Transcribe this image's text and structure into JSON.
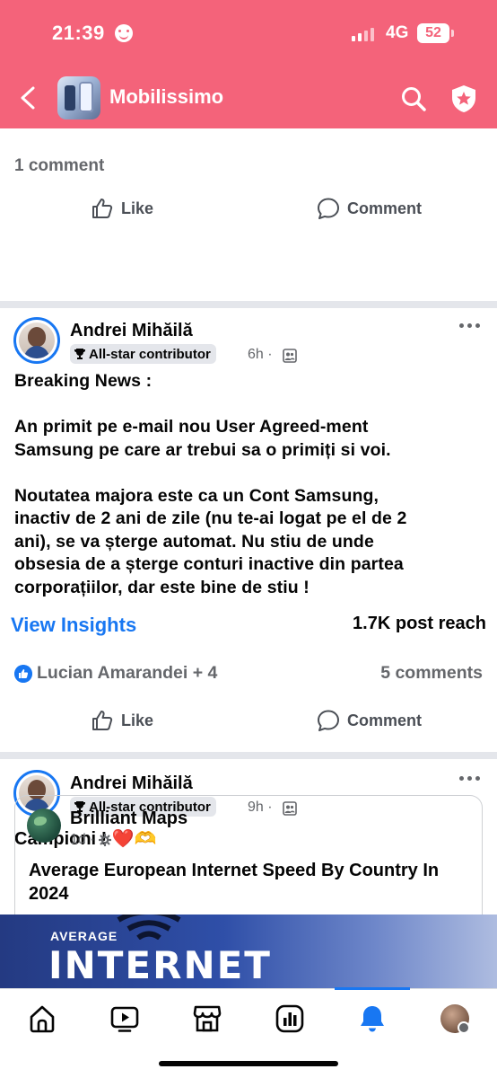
{
  "status_bar": {
    "time": "21:39",
    "network": "4G",
    "battery": "52"
  },
  "header": {
    "group_name": "Mobilissimo"
  },
  "previous_post": {
    "comment_count": "1 comment",
    "like_label": "Like",
    "comment_label": "Comment"
  },
  "post1": {
    "author": "Andrei Mihăilă",
    "badge": "All-star contributor",
    "time": "6h ·",
    "text": [
      "Breaking News :",
      "",
      "An primit pe e-mail nou User Agreed-ment",
      "Samsung pe care ar trebui sa o primiți si voi.",
      "",
      "Noutatea majora este ca un Cont Samsung,",
      "inactiv de 2 ani de zile (nu te-ai logat pe el de 2",
      "ani), se va șterge automat. Nu stiu de unde",
      "obsesia de a șterge conturi inactive din partea",
      "corporațiilor, dar este bine de stiu !"
    ],
    "insights_label": "View Insights",
    "post_reach": "1.7K post reach",
    "reactors": "Lucian Amarandei + 4",
    "comments": "5 comments",
    "like_label": "Like",
    "comment_label": "Comment"
  },
  "post2": {
    "author": "Andrei Mihăilă",
    "badge": "All-star contributor",
    "time": "9h ·",
    "text": "Campioni ! ❤️🫶",
    "shared": {
      "page_name": "Brilliant Maps",
      "time": "1d ·",
      "title": "Average European Internet Speed By Country In 2024",
      "image_text_small": "AVERAGE",
      "image_text_big": "INTERNET"
    }
  },
  "tabbar": {
    "items": [
      "home-icon",
      "video-icon",
      "marketplace-icon",
      "dashboard-icon",
      "notifications-icon",
      "profile-avatar"
    ],
    "active": "notifications-icon",
    "accent": "#1877f2"
  },
  "colors": {
    "header_bg": "#f4637a",
    "link_blue": "#1877f2",
    "secondary_text": "#65676b"
  }
}
